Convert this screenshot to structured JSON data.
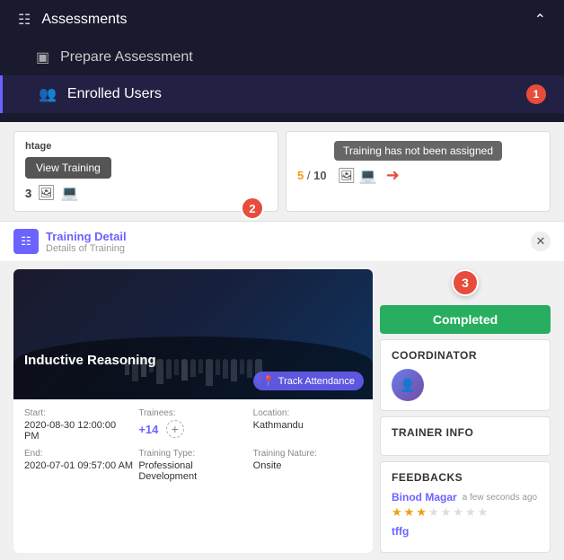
{
  "nav": {
    "assessments_label": "Assessments",
    "prepare_assessment_label": "Prepare Assessment",
    "enrolled_users_label": "Enrolled Users",
    "enrolled_badge": "1"
  },
  "steps": {
    "card1": {
      "title": "htage",
      "view_training_label": "View Training",
      "number": "3",
      "step_num": "2"
    },
    "card2": {
      "not_assigned": "Training has not been assigned",
      "fraction_num": "5",
      "fraction_denom": "10",
      "step_num_label": ""
    }
  },
  "panel": {
    "title": "Training Detail",
    "subtitle": "Details of Training"
  },
  "training": {
    "title": "Inductive Reasoning",
    "track_attendance_label": "Track Attendance",
    "start_label": "Start:",
    "start_value": "2020-08-30 12:00:00 PM",
    "end_label": "End:",
    "end_value": "2020-07-01 09:57:00 AM",
    "trainees_label": "Trainees:",
    "trainees_value": "+14",
    "location_label": "Location:",
    "location_value": "Kathmandu",
    "training_type_label": "Training Type:",
    "training_type_value": "Professional Development",
    "training_nature_label": "Training Nature:",
    "training_nature_value": "Onsite"
  },
  "right": {
    "step3_num": "3",
    "status": "Completed",
    "coordinator_section": "COORDINATOR",
    "trainer_info_section": "TRAINER INFO",
    "feedbacks_section": "FEEDBACKS"
  },
  "feedbacks": [
    {
      "name": "Binod Magar",
      "time": "a few seconds ago",
      "stars": [
        1,
        1,
        1,
        0,
        0,
        0,
        0,
        0
      ],
      "text": ""
    },
    {
      "name": "tffg",
      "time": "",
      "stars": [],
      "text": ""
    }
  ]
}
